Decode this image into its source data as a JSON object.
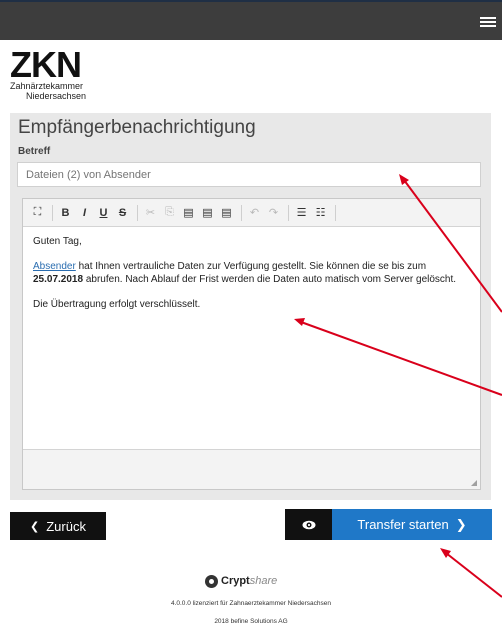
{
  "header": {
    "menu_icon": "hamburger-icon"
  },
  "logo": {
    "brand": "ZKN",
    "line1": "Zahnärztekammer",
    "line2": "Niedersachsen"
  },
  "panel": {
    "title": "Empfängerbenachrichtigung",
    "subject_label": "Betreff",
    "subject_placeholder": "Dateien (2) von Absender"
  },
  "toolbar": {
    "items": [
      {
        "icon": "fullscreen-icon",
        "glyph": "⛶"
      },
      {
        "icon": "bold-icon",
        "glyph": "B"
      },
      {
        "icon": "italic-icon",
        "glyph": "I"
      },
      {
        "icon": "underline-icon",
        "glyph": "U"
      },
      {
        "icon": "strikethrough-icon",
        "glyph": "S"
      },
      {
        "icon": "cut-icon",
        "glyph": "✂"
      },
      {
        "icon": "copy-icon",
        "glyph": "⎘"
      },
      {
        "icon": "paste-icon",
        "glyph": "▤"
      },
      {
        "icon": "paste-text-icon",
        "glyph": "▤"
      },
      {
        "icon": "paste-word-icon",
        "glyph": "▤"
      },
      {
        "icon": "undo-icon",
        "glyph": "↶"
      },
      {
        "icon": "redo-icon",
        "glyph": "↷"
      },
      {
        "icon": "numbered-list-icon",
        "glyph": "☰"
      },
      {
        "icon": "bullet-list-icon",
        "glyph": "☷"
      }
    ]
  },
  "editor": {
    "greeting": "Guten Tag,",
    "sender_link": "Absender",
    "text_part1": " hat Ihnen vertrauliche Daten zur Verfügung gestellt. Sie können die se bis zum ",
    "date": "25.07.2018",
    "text_part2": " abrufen. Nach Ablauf der Frist werden die Daten auto matisch vom Server gelöscht.",
    "encryption_note": "Die Übertragung erfolgt verschlüsselt."
  },
  "actions": {
    "back_label": "Zurück",
    "preview_icon": "eye-icon",
    "transfer_label": "Transfer starten"
  },
  "footer": {
    "brand_crypt": "Crypt",
    "brand_share": "share",
    "license": "4.0.0.0 lizenziert für Zahnaerztekammer Niedersachsen",
    "copyright": "2018 befine Solutions AG"
  },
  "colors": {
    "accent": "#1f78c8",
    "topbar": "#3d3d3d",
    "panel": "#e8e8e8",
    "annotation_arrow": "#d9001b"
  }
}
